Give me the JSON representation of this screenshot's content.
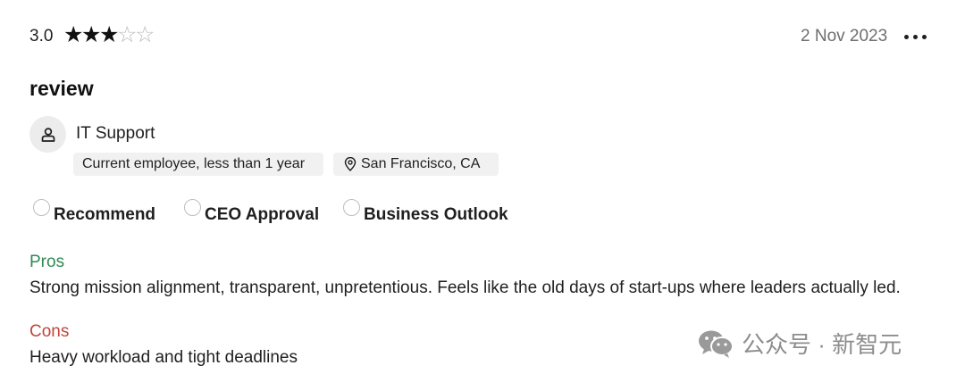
{
  "header": {
    "rating": "3.0",
    "stars_filled": 3,
    "stars_total": 5,
    "date": "2 Nov 2023"
  },
  "review": {
    "title": "review",
    "job_title": "IT Support",
    "employment": "Current employee, less than 1 year",
    "location": "San Francisco, CA"
  },
  "recommendations": {
    "recommend": "Recommend",
    "ceo_approval": "CEO Approval",
    "business_outlook": "Business Outlook"
  },
  "pros": {
    "heading": "Pros",
    "text": "Strong mission alignment, transparent, unpretentious. Feels like the old days of start-ups where leaders actually led."
  },
  "cons": {
    "heading": "Cons",
    "text": "Heavy workload and tight deadlines"
  },
  "watermark": {
    "text": "公众号 · 新智元"
  },
  "icons": {
    "star": "star-icon",
    "more": "more-options-icon",
    "avatar": "person-icon",
    "location": "location-pin-icon",
    "watermark": "wechat-icon"
  },
  "colors": {
    "pros": "#2f8a55",
    "cons": "#c0453c",
    "tag_bg": "#f1f1f1"
  }
}
